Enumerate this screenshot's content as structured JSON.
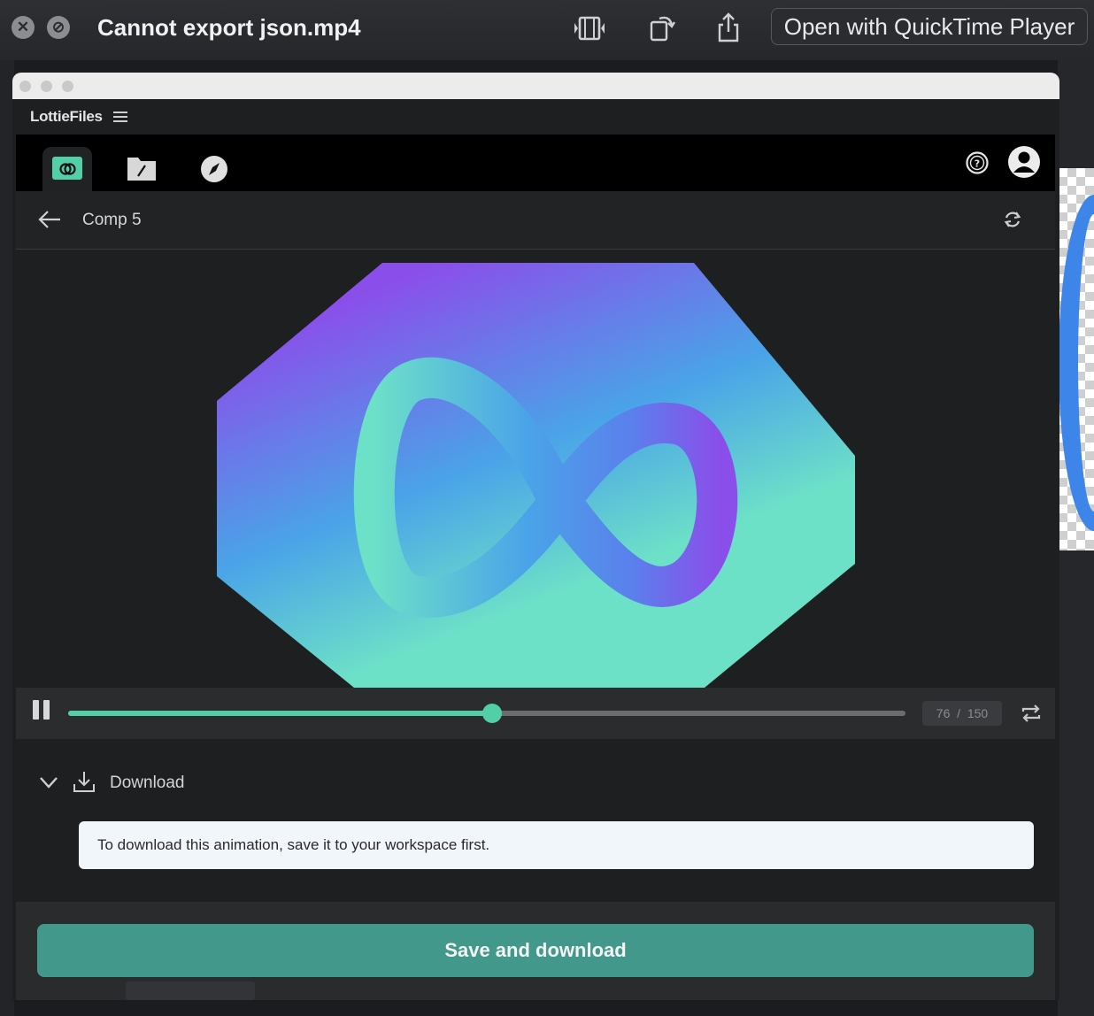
{
  "quicklook": {
    "title": "Cannot export json.mp4",
    "close_icon": "close-icon",
    "markup_icon": "markup-icon",
    "trim_icon": "trim-video-icon",
    "rotate_icon": "rotate-icon",
    "share_icon": "share-icon",
    "open_with_label": "Open with QuickTime Player"
  },
  "plugin": {
    "app_title": "LottieFiles",
    "tabs": [
      {
        "icon": "preview-icon",
        "active": true
      },
      {
        "icon": "folder-icon",
        "active": false
      },
      {
        "icon": "discover-icon",
        "active": false
      }
    ],
    "help_icon": "help-icon",
    "avatar_icon": "user-avatar-icon",
    "comp_title": "Comp 5",
    "player": {
      "current_frame": "76",
      "frame_separator": "/",
      "total_frames": "150",
      "progress": 0.5067
    },
    "download": {
      "label": "Download",
      "notice": "To download this animation, save it to your workspace first.",
      "button_label": "Save and download"
    },
    "colors": {
      "accent": "#53cfa8",
      "button": "#42998b",
      "gradient_purple": "#8a4fea",
      "gradient_blue": "#4aa3e8",
      "gradient_mint": "#6de0c8"
    }
  }
}
